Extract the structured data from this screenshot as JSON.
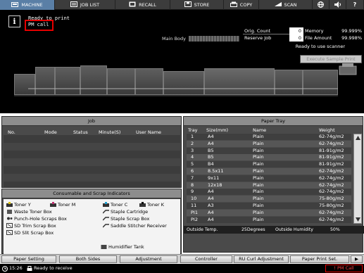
{
  "nav": {
    "tabs": [
      {
        "label": "MACHINE",
        "icon": "machine-icon"
      },
      {
        "label": "JOB LIST",
        "icon": "job-list-icon"
      },
      {
        "label": "RECALL",
        "icon": "recall-icon"
      },
      {
        "label": "STORE",
        "icon": "store-icon"
      },
      {
        "label": "COPY",
        "icon": "copy-icon"
      },
      {
        "label": "SCAN",
        "icon": "scan-icon"
      }
    ],
    "right_icons": [
      "globe-icon",
      "speaker-icon",
      "help-icon"
    ],
    "help_label": "?"
  },
  "status": {
    "info_glyph": "i",
    "line1": "Ready to print",
    "line2": "PM call",
    "main_body_label": "Main Body",
    "scanner_msg": "Ready to use scanner",
    "execute_sample_label": "Execute Sample Print"
  },
  "counts": {
    "orig_count_label": "Orig. Count",
    "orig_count_value": "0",
    "reserve_job_label": "Reserve Job",
    "reserve_job_value": "0",
    "memory_label": "Memory",
    "memory_value": "99.999%",
    "file_amount_label": "File Amount",
    "file_amount_value": "99.998%"
  },
  "job": {
    "title": "Job",
    "columns": [
      "No.",
      "Mode",
      "Status",
      "Minute(S)",
      "User Name"
    ]
  },
  "consumables": {
    "title": "Consumable and Scrap Indicators",
    "items": [
      {
        "label": "Toner Y",
        "icon": "toner-icon"
      },
      {
        "label": "Toner M",
        "icon": "toner-icon"
      },
      {
        "label": "Toner C",
        "icon": "toner-icon"
      },
      {
        "label": "Toner K",
        "icon": "toner-icon"
      },
      {
        "label": "Waste Toner Box",
        "icon": "waste-toner-icon"
      },
      {
        "label": "Staple Cartridge",
        "icon": "staple-icon"
      },
      {
        "label": "Punch-Hole Scraps Box",
        "icon": "punch-hole-icon"
      },
      {
        "label": "Staple Scrap Box",
        "icon": "staple-icon"
      },
      {
        "label": "SD Trim Scrap Box",
        "icon": "trim-box-icon"
      },
      {
        "label": "Saddle Stitcher Receiver",
        "icon": "staple-icon"
      },
      {
        "label": "SD Slit Scrap Box",
        "icon": "trim-box-icon"
      },
      {
        "label": "Humidifier Tank",
        "icon": "humidifier-icon"
      }
    ]
  },
  "paper_tray": {
    "title": "Paper Tray",
    "columns": [
      "Tray",
      "Size(mm)",
      "Name",
      "Weight"
    ],
    "rows": [
      {
        "tray": "1",
        "size": "A4",
        "name": "Plain",
        "weight": "62-74g/m2"
      },
      {
        "tray": "2",
        "size": "A4",
        "name": "Plain",
        "weight": "62-74g/m2"
      },
      {
        "tray": "3",
        "size": "B5",
        "name": "Plain",
        "weight": "81-91g/m2"
      },
      {
        "tray": "4",
        "size": "B5",
        "name": "Plain",
        "weight": "81-91g/m2"
      },
      {
        "tray": "5",
        "size": "B4",
        "name": "Plain",
        "weight": "81-91g/m2"
      },
      {
        "tray": "6",
        "size": "8.5x11",
        "name": "Plain",
        "weight": "62-74g/m2"
      },
      {
        "tray": "7",
        "size": "9x11",
        "name": "Plain",
        "weight": "62-74g/m2"
      },
      {
        "tray": "8",
        "size": "12x18",
        "name": "Plain",
        "weight": "62-74g/m2"
      },
      {
        "tray": "9",
        "size": "A4",
        "name": "Plain",
        "weight": "62-74g/m2"
      },
      {
        "tray": "10",
        "size": "A4",
        "name": "Plain",
        "weight": "75-80g/m2"
      },
      {
        "tray": "11",
        "size": "A3",
        "name": "Plain",
        "weight": "75-80g/m2"
      },
      {
        "tray": "PI1",
        "size": "A4",
        "name": "Plain",
        "weight": "62-74g/m2"
      },
      {
        "tray": "PI2",
        "size": "A4",
        "name": "Plain",
        "weight": "62-74g/m2"
      }
    ],
    "outside_temp_label": "Outside Temp.",
    "outside_temp_value": "25Degrees",
    "outside_humidity_label": "Outside Humidity",
    "outside_humidity_value": "50%"
  },
  "bottom": {
    "buttons": [
      "Paper Setting",
      "Both Sides",
      "Adjustment",
      "Controller",
      "RU Curl Adjustment",
      "Paper Print Set."
    ],
    "next_glyph": "▶",
    "time": "15:26",
    "status": "Ready to receive",
    "pm_call": "PM Call"
  },
  "colors": {
    "active_tab": "#5a7fa6",
    "alert_red": "#e60000"
  }
}
